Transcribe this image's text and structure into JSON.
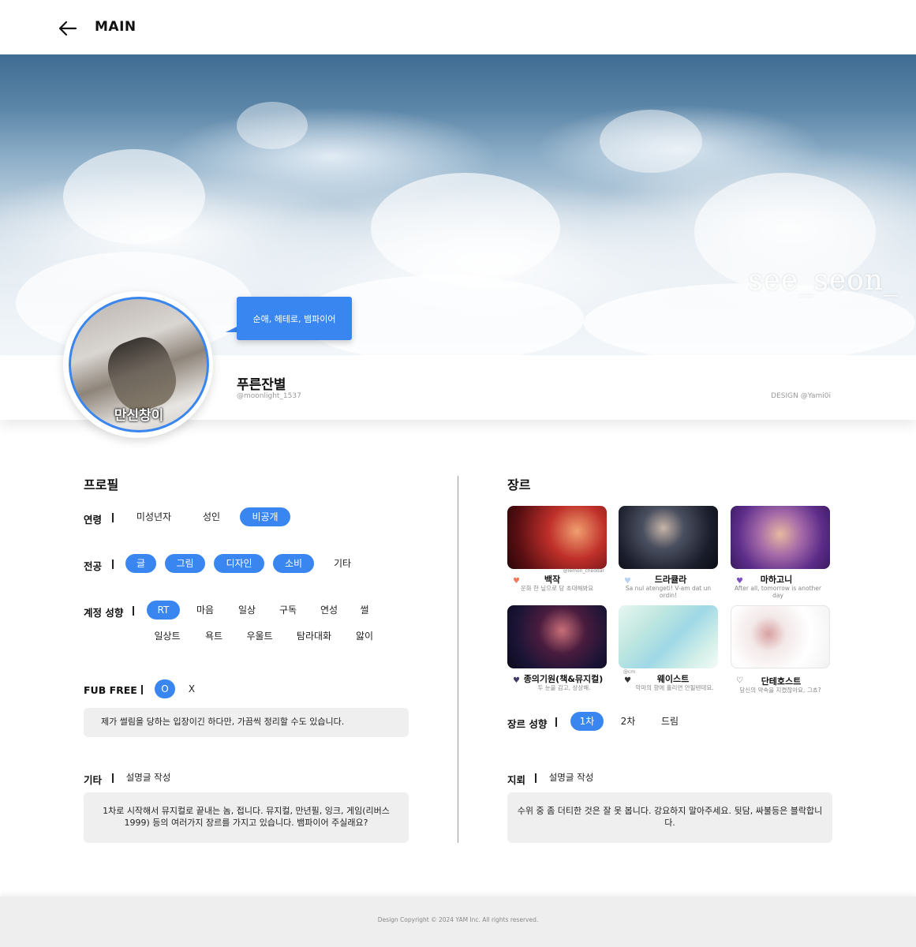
{
  "header": {
    "title": "MAIN"
  },
  "hero": {
    "watermark": "see_seon_"
  },
  "profile": {
    "bubble": "순애, 헤테로, 뱀파이어",
    "avatar_caption": "만신창이",
    "name": "푸른잔별",
    "handle": "@moonlight_1537",
    "design_credit": "DESIGN @Yami0i"
  },
  "left": {
    "title": "프로필",
    "age": {
      "label": "연령",
      "options": [
        "미성년자",
        "성인",
        "비공개"
      ],
      "selected": "비공개"
    },
    "major": {
      "label": "전공",
      "options": [
        "글",
        "그림",
        "디자인",
        "소비",
        "기타"
      ],
      "selected": [
        "글",
        "그림",
        "디자인",
        "소비"
      ]
    },
    "tendency": {
      "label": "계정 성향",
      "row1": [
        "RT",
        "마음",
        "일상",
        "구독",
        "연성",
        "썰"
      ],
      "row2": [
        "일상트",
        "욕트",
        "우울트",
        "탐라대화",
        "앓이"
      ],
      "selected": [
        "RT"
      ]
    },
    "fub": {
      "label": "FUB FREE",
      "options": [
        "O",
        "X"
      ],
      "selected": "O",
      "note": "제가 썰림을 당하는 입장이긴 하다만, 가끔씩 정리할 수도 있습니다."
    },
    "etc": {
      "label": "기타",
      "hint": "설명글 작성",
      "text": "1차로 시작해서 뮤지컬로 끝내는 놈, 접니다. 뮤지컬, 만년필, 잉크, 게임(리버스1999) 등의 여러가지 장르를 가지고 있습니다. 뱀파이어 주실래요?"
    }
  },
  "right": {
    "title": "장르",
    "genres": [
      {
        "name": "백작",
        "sub": "운화 한 닢으로 당 초대해봐요",
        "credit": "@lemon_cheddar",
        "heart": "♥",
        "heart_color": "#f07a5a"
      },
      {
        "name": "드라큘라",
        "sub": "Sa nul atengeti! V-am dat un ordin!",
        "credit": "",
        "heart": "♥",
        "heart_color": "#b9d3f0"
      },
      {
        "name": "마하고니",
        "sub": "After all, tomorrow is another day",
        "credit": "",
        "heart": "♥",
        "heart_color": "#7b4fc0"
      },
      {
        "name": "종의기원(책&뮤지컬)",
        "sub": "두 눈을 감고, 상상해.",
        "credit": "",
        "heart": "♥",
        "heart_color": "#443a66"
      },
      {
        "name": "웨이스트",
        "sub": "악마의 향에 홀리면 안될텐데요.",
        "credit": "@cm",
        "heart": "♥",
        "heart_color": "#333333"
      },
      {
        "name": "단테호스트",
        "sub": "당신의 약속을 지켰잖아요, 그쵸?",
        "credit": "",
        "heart": "♡",
        "heart_color": "#333333"
      }
    ],
    "genre_tendency": {
      "label": "장르 성향",
      "options": [
        "1차",
        "2차",
        "드림"
      ],
      "selected": "1차"
    },
    "mine": {
      "label": "지뢰",
      "hint": "설명글 작성",
      "text": "수위 중 좀 더티한 것은 잘 못 봅니다. 강요하지 말아주세요. 뒷담, 싸불등은 블락합니다."
    }
  },
  "footer": {
    "copyright": "Design Copyright © 2024 YAM Inc. All rights reserved."
  },
  "colors": {
    "accent": "#3a86f0"
  }
}
